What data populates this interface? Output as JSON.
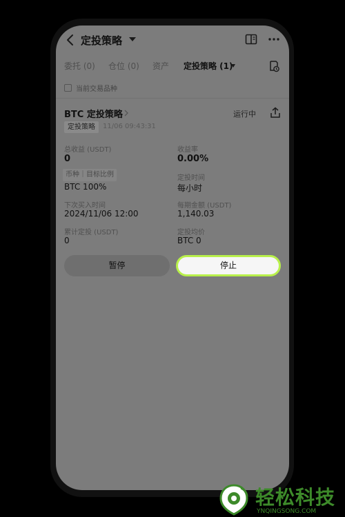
{
  "header": {
    "title": "定投策略",
    "icons": [
      "back-icon",
      "book-icon",
      "more-icon",
      "caret-down-icon"
    ]
  },
  "tabs": [
    {
      "label": "委托 (0)",
      "active": false
    },
    {
      "label": "仓位 (0)",
      "active": false
    },
    {
      "label": "资产",
      "active": false
    },
    {
      "label": "定投策略 (1)",
      "active": true
    }
  ],
  "filter": {
    "label": "当前交易品种",
    "checked": false
  },
  "card": {
    "title": "BTC 定投策略",
    "status": "运行中",
    "tag": "定投策略",
    "timestamp": "11/06 09:43:31"
  },
  "stats": {
    "total_profit_label": "总收益 (USDT)",
    "total_profit_value": "0",
    "yield_label": "收益率",
    "yield_value": "0.00%",
    "coin_label": "币种｜目标比例",
    "coin_value": "BTC 100%",
    "schedule_label": "定投时间",
    "schedule_value": "每小时",
    "next_buy_label": "下次买入时间",
    "next_buy_value": "2024/11/06 12:00",
    "amount_label": "每期金额 (USDT)",
    "amount_value": "1,140.03",
    "cumulative_label": "累计定投 (USDT)",
    "cumulative_value": "0",
    "avg_price_label": "定投均价",
    "avg_price_value": "BTC 0"
  },
  "buttons": {
    "pause": "暂停",
    "stop": "停止"
  },
  "watermark": {
    "title": "轻松科技",
    "subtitle": "YNQINGSONG.COM"
  },
  "colors": {
    "accent": "#b8f04a",
    "overlay_gray": "#7c7c7c",
    "watermark_green": "#3d8a2a"
  }
}
